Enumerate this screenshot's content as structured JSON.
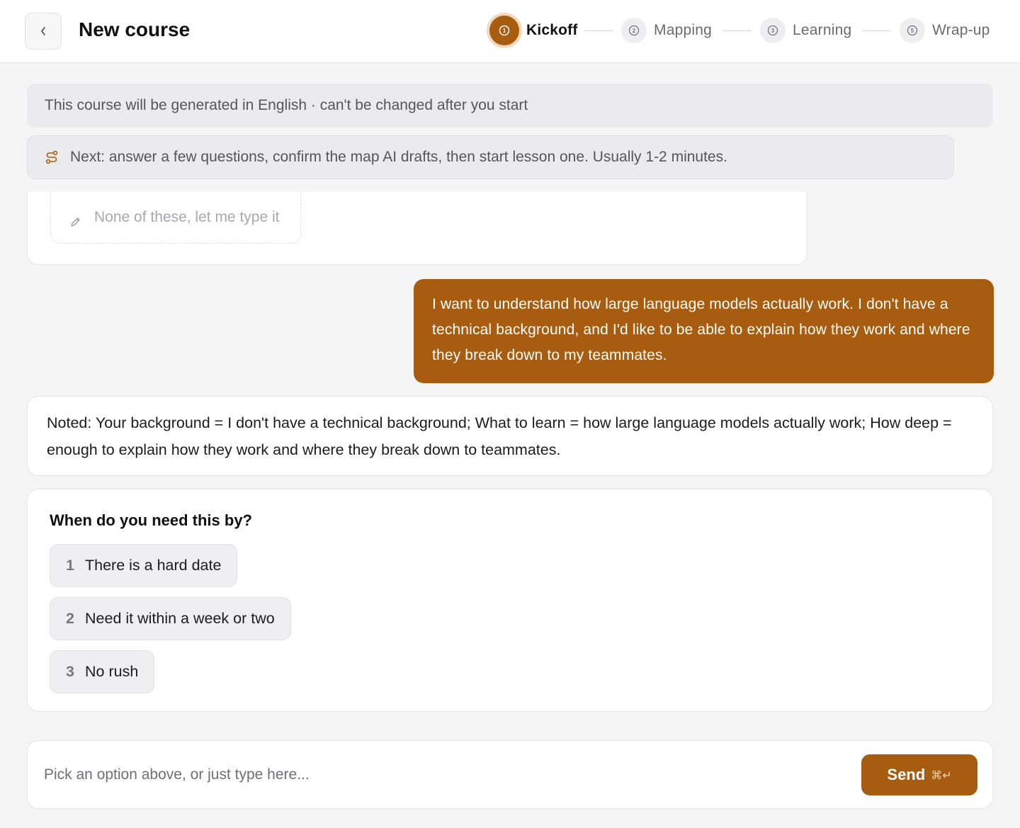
{
  "header": {
    "back_icon": "chevron-left-icon",
    "title": "New course",
    "steps": [
      {
        "number": "1",
        "label": "Kickoff",
        "active": true
      },
      {
        "number": "2",
        "label": "Mapping",
        "active": false
      },
      {
        "number": "3",
        "label": "Learning",
        "active": false
      },
      {
        "number": "5",
        "label": "Wrap-up",
        "active": false
      }
    ]
  },
  "banner": {
    "language_notice": "This course will be generated in English · can't be changed after you start"
  },
  "hint": {
    "icon": "route-icon",
    "text": "Next: answer a few questions, confirm the map AI drafts, then start lesson one. Usually 1-2 minutes."
  },
  "previous_question": {
    "none_option_label": "None of these, let me type it",
    "icon": "pencil-icon"
  },
  "user_message": {
    "text": "I want to understand how large language models actually work. I don't have a technical background, and I'd like to be able to explain how they work and where they break down to my teammates."
  },
  "assistant_note": {
    "text": "Noted: Your background = I don't have a technical background; What to learn = how large language models actually work; How deep = enough to explain how they work and where they break down to teammates."
  },
  "question": {
    "title": "When do you need this by?",
    "options": [
      {
        "number": "1",
        "label": "There is a hard date"
      },
      {
        "number": "2",
        "label": "Need it within a week or two"
      },
      {
        "number": "3",
        "label": "No rush"
      }
    ]
  },
  "composer": {
    "placeholder": "Pick an option above, or just type here...",
    "value": "",
    "send_label": "Send",
    "shortcut": "⌘↵"
  },
  "colors": {
    "accent": "#a85c0f",
    "accent_ring": "#f2d9bd",
    "page_bg": "#f5f5f6"
  }
}
